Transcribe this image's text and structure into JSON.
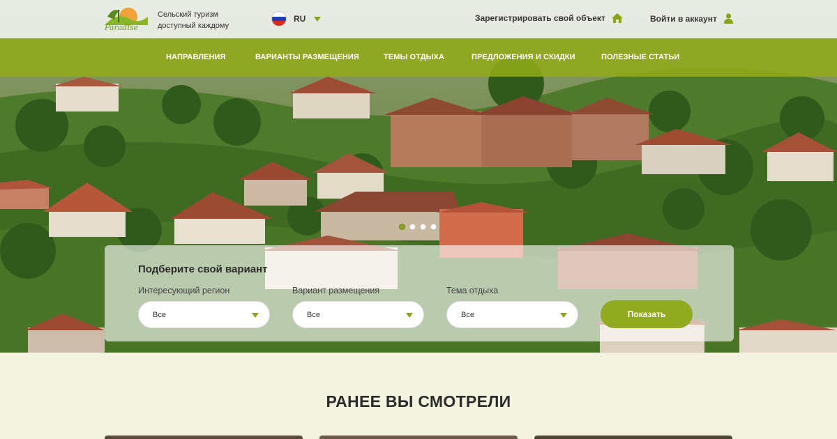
{
  "header": {
    "logo_text": "Paradise",
    "tagline": [
      "Сельский туризм",
      "доступный каждому"
    ],
    "language": "RU",
    "register_label": "Зарегистрировать свой объект",
    "login_label": "Войти в аккаунт"
  },
  "nav": {
    "items": [
      {
        "label": "НАПРАВЛЕНИЯ"
      },
      {
        "label": "ВАРИАНТЫ РАЗМЕЩЕНИЯ"
      },
      {
        "label": "ТЕМЫ ОТДЫХА"
      },
      {
        "label": "ПРЕДЛОЖЕНИЯ И СКИДКИ"
      },
      {
        "label": "ПОЛЕЗНЫЕ СТАТЬИ"
      }
    ]
  },
  "slider": {
    "count": 4,
    "active_index": 0
  },
  "search": {
    "title": "Подберите свой вариант",
    "fields": [
      {
        "label": "Интересующий регион",
        "value": "Все"
      },
      {
        "label": "Вариант размещения",
        "value": "Все"
      },
      {
        "label": "Тема отдыха",
        "value": "Все"
      }
    ],
    "submit_label": "Показать"
  },
  "recent": {
    "title": "РАНЕЕ ВЫ СМОТРЕЛИ"
  },
  "colors": {
    "accent": "#92aa1f",
    "nav_band": "#91aa19",
    "page_bg": "#f3f3df"
  },
  "icons": {
    "language_dropdown": "chevron-down-icon",
    "register": "house-icon",
    "login": "user-icon"
  }
}
